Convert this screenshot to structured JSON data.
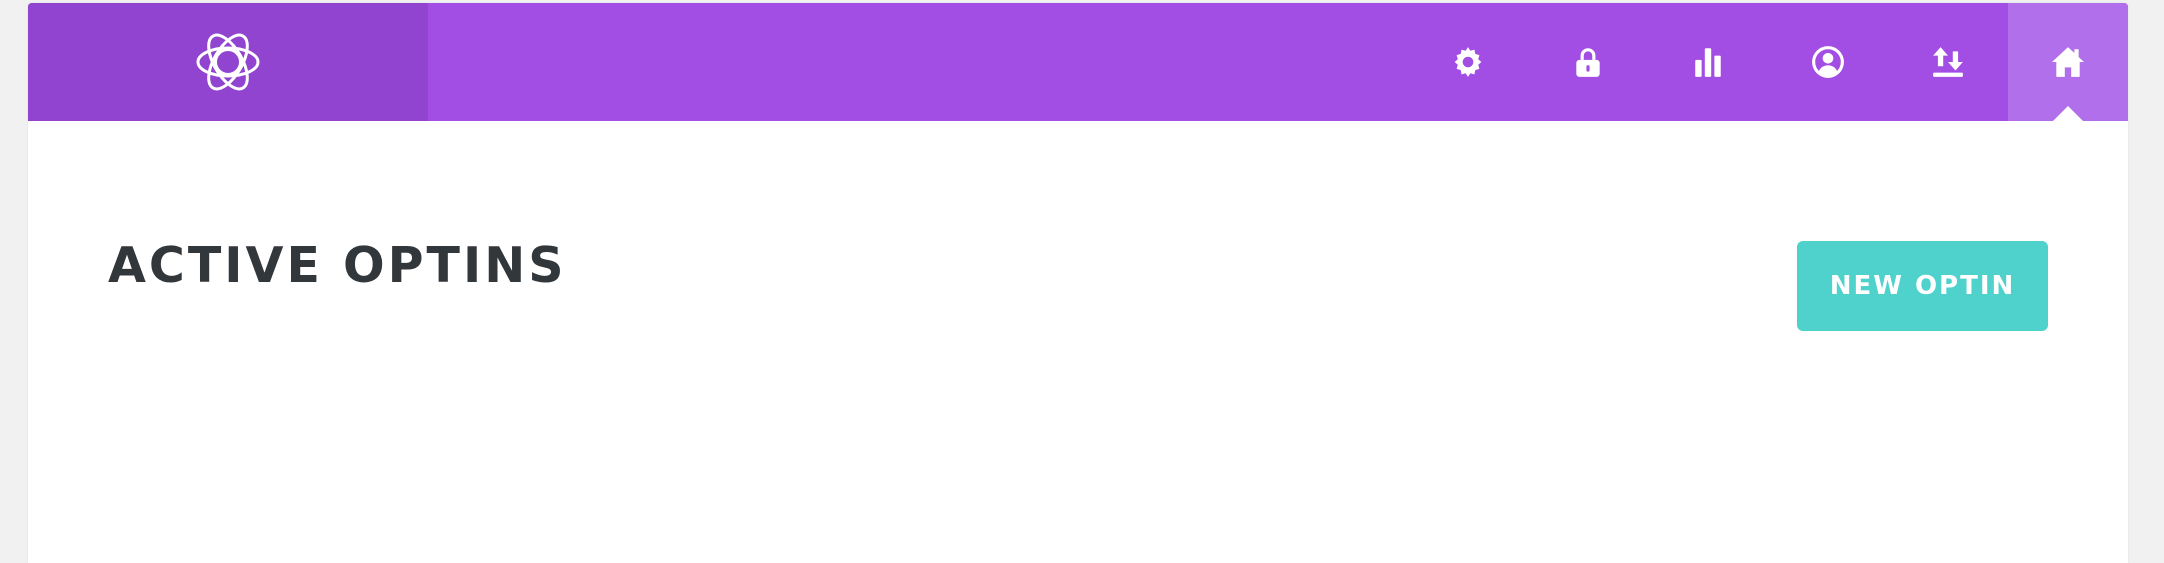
{
  "header": {
    "logo_icon": "bloom-logo-icon",
    "nav": [
      {
        "icon": "gear-icon",
        "active": false
      },
      {
        "icon": "lock-icon",
        "active": false
      },
      {
        "icon": "bar-chart-icon",
        "active": false
      },
      {
        "icon": "user-circle-icon",
        "active": false
      },
      {
        "icon": "import-export-icon",
        "active": false
      },
      {
        "icon": "home-icon",
        "active": true
      }
    ]
  },
  "main": {
    "title": "ACTIVE OPTINS",
    "new_button_label": "NEW OPTIN"
  },
  "colors": {
    "topbar": "#a24de3",
    "logo_block": "#9044cf",
    "active_tab": "#b26fec",
    "accent_button": "#4fd2cc",
    "title_text": "#32373c"
  }
}
